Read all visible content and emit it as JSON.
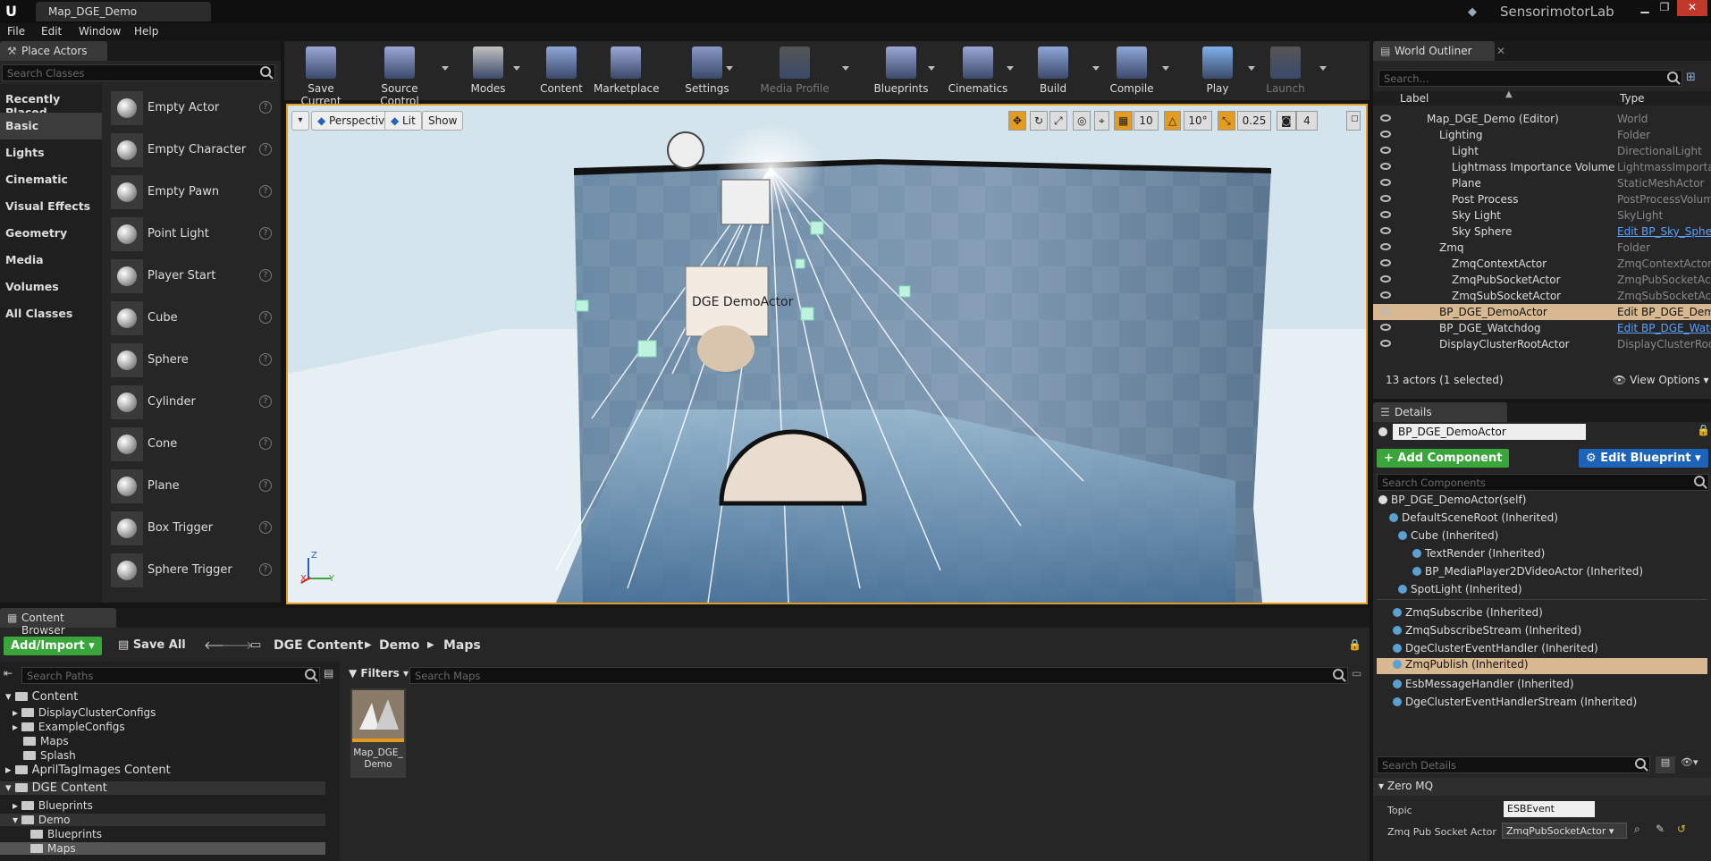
{
  "window": {
    "tab_title": "Map_DGE_Demo",
    "brand": "SensorimotorLab",
    "logo": "U"
  },
  "menu": [
    "File",
    "Edit",
    "Window",
    "Help"
  ],
  "place_actors": {
    "tab": "Place Actors",
    "search_placeholder": "Search Classes",
    "categories": [
      "Recently Placed",
      "Basic",
      "Lights",
      "Cinematic",
      "Visual Effects",
      "Geometry",
      "Media",
      "Volumes",
      "All Classes"
    ],
    "selected_category": "Basic",
    "items": [
      "Empty Actor",
      "Empty Character",
      "Empty Pawn",
      "Point Light",
      "Player Start",
      "Cube",
      "Sphere",
      "Cylinder",
      "Cone",
      "Plane",
      "Box Trigger",
      "Sphere Trigger"
    ]
  },
  "toolbar": {
    "buttons": [
      {
        "label": "Save Current",
        "color": "#9aa7d6"
      },
      {
        "label": "Source Control",
        "color": "#9aa7d6"
      },
      {
        "label": "Modes",
        "color": "#c0c0c0"
      },
      {
        "label": "Content",
        "color": "#8fa6d8"
      },
      {
        "label": "Marketplace",
        "color": "#9aa7d6"
      },
      {
        "label": "Settings",
        "color": "#8a98c8"
      },
      {
        "label": "Media Profile",
        "color": "#555555"
      },
      {
        "label": "Blueprints",
        "color": "#9aa7d6"
      },
      {
        "label": "Cinematics",
        "color": "#9aa7d6"
      },
      {
        "label": "Build",
        "color": "#8fa6d8"
      },
      {
        "label": "Compile",
        "color": "#8fa6d8"
      },
      {
        "label": "Play",
        "color": "#7fb0e8"
      },
      {
        "label": "Launch",
        "color": "#555555"
      }
    ]
  },
  "viewport": {
    "perspective": "Perspective",
    "lit": "Lit",
    "show": "Show",
    "grid_snap": "10",
    "rot_snap": "10°",
    "scale_snap": "0.25",
    "cam_speed": "4",
    "sign_text": "DGE DemoActor",
    "axis_z": "Z",
    "axis_x": "X",
    "axis_y": "Y"
  },
  "outliner": {
    "tab": "World Outliner",
    "search_placeholder": "Search...",
    "col_label": "Label",
    "col_type": "Type",
    "rows": [
      {
        "name": "Map_DGE_Demo (Editor)",
        "type": "World"
      },
      {
        "name": "Lighting",
        "type": "Folder"
      },
      {
        "name": "Light",
        "type": "DirectionalLight"
      },
      {
        "name": "Lightmass Importance Volume",
        "type": "LightmassImportanceVolume"
      },
      {
        "name": "Plane",
        "type": "StaticMeshActor"
      },
      {
        "name": "Post Process",
        "type": "PostProcessVolume"
      },
      {
        "name": "Sky Light",
        "type": "SkyLight"
      },
      {
        "name": "Sky Sphere",
        "type": "Edit BP_Sky_Sphere"
      },
      {
        "name": "Zmq",
        "type": "Folder"
      },
      {
        "name": "ZmqContextActor",
        "type": "ZmqContextActor"
      },
      {
        "name": "ZmqPubSocketActor",
        "type": "ZmqPubSocketActor"
      },
      {
        "name": "ZmqSubSocketActor",
        "type": "ZmqSubSocketActor"
      },
      {
        "name": "BP_DGE_DemoActor",
        "type": "Edit BP_DGE_DemoActor"
      },
      {
        "name": "BP_DGE_Watchdog",
        "type": "Edit BP_DGE_Watchdog"
      },
      {
        "name": "DisplayClusterRootActor",
        "type": "DisplayClusterRootActor"
      }
    ],
    "status": "13 actors (1 selected)",
    "view_options": "View Options"
  },
  "details": {
    "tab": "Details",
    "actor_name": "BP_DGE_DemoActor",
    "add_component": "+ Add Component",
    "edit_blueprint": "Edit Blueprint",
    "search_components": "Search Components",
    "self": "BP_DGE_DemoActor(self)",
    "components": [
      "DefaultSceneRoot (Inherited)",
      "Cube (Inherited)",
      "TextRender (Inherited)",
      "BP_MediaPlayer2DVideoActor (Inherited)",
      "SpotLight (Inherited)",
      "ZmqSubscribe (Inherited)",
      "ZmqSubscribeStream (Inherited)",
      "DgeClusterEventHandler (Inherited)",
      "ZmqPublish (Inherited)",
      "EsbMessageHandler (Inherited)",
      "DgeClusterEventHandlerStream (Inherited)"
    ],
    "search_details": "Search Details",
    "section": "Zero MQ",
    "topic_label": "Topic",
    "topic_value": "ESBEvent",
    "socket_label": "Zmq Pub Socket Actor",
    "socket_value": "ZmqPubSocketActor"
  },
  "content_browser": {
    "tab": "Content Browser",
    "add_import": "Add/Import",
    "save_all": "Save All",
    "path": [
      "DGE Content",
      "Demo",
      "Maps"
    ],
    "search_paths": "Search Paths",
    "filters": "Filters",
    "search_maps": "Search Maps",
    "tree": [
      "Content",
      "DisplayClusterConfigs",
      "ExampleConfigs",
      "Maps",
      "Splash",
      "AprilTagImages Content",
      "DGE Content",
      "Blueprints",
      "Demo",
      "Blueprints",
      "Maps"
    ],
    "asset_name": "Map_DGE_Demo",
    "asset_line1": "Map_DGE_",
    "asset_line2": "Demo"
  }
}
